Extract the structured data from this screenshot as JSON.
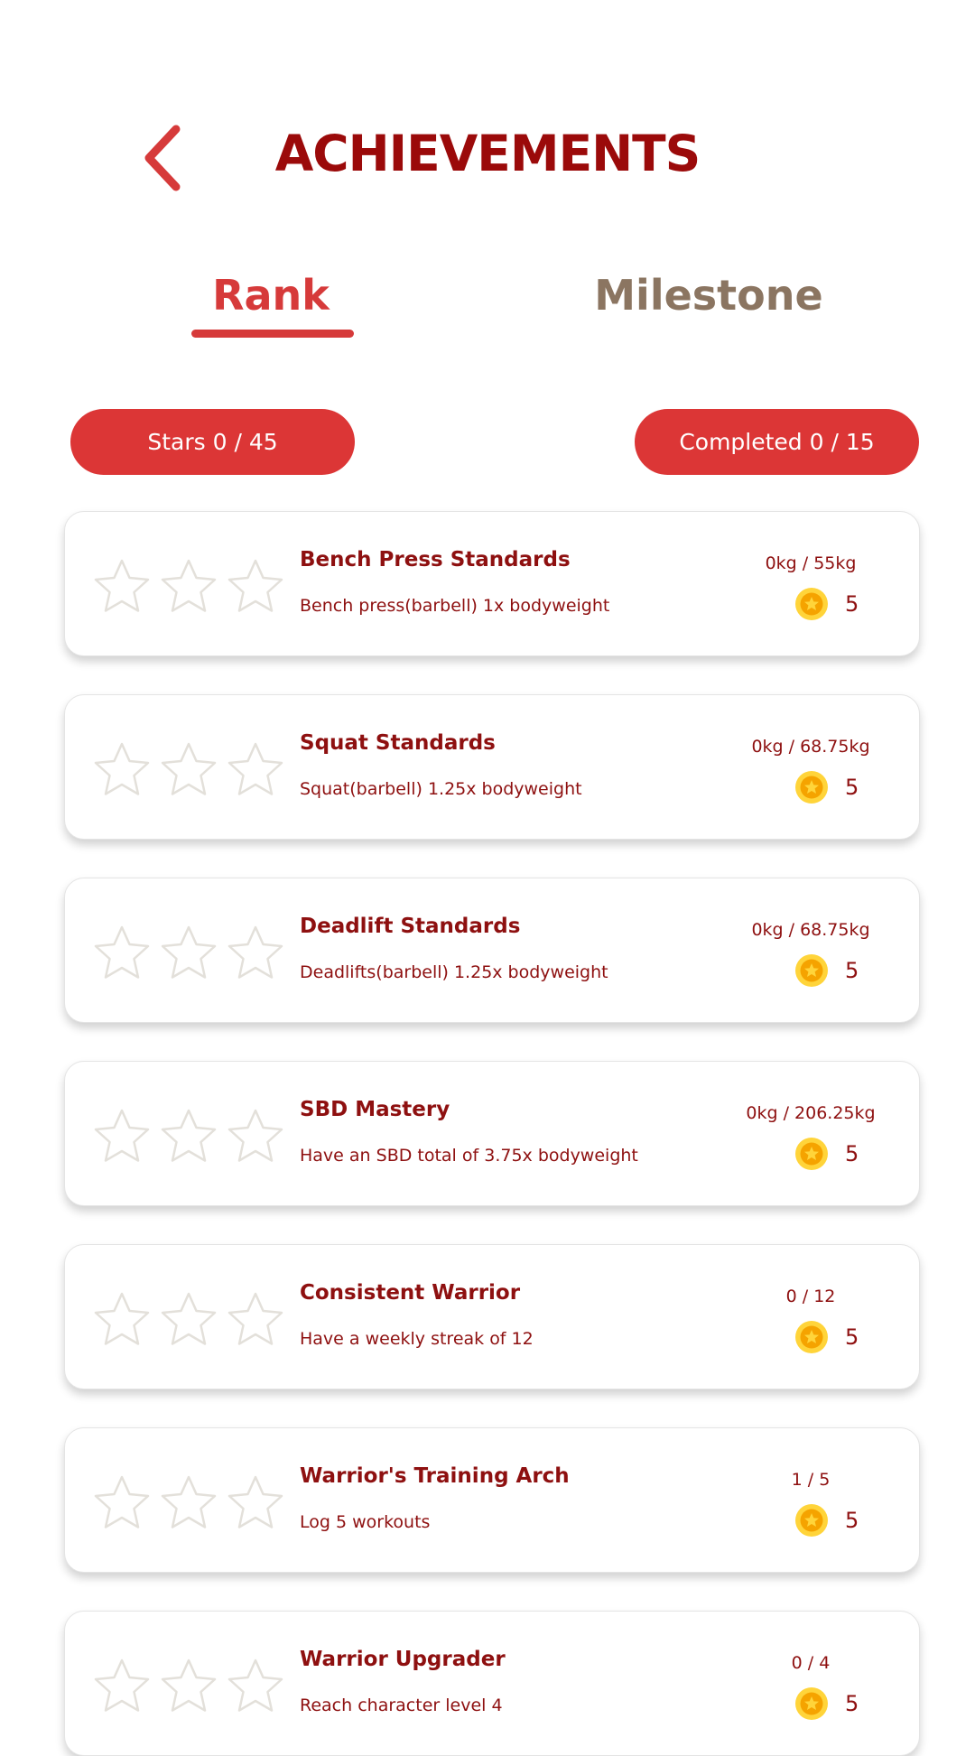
{
  "header": {
    "title": "ACHIEVEMENTS",
    "back_icon": "chevron-left-icon"
  },
  "tabs": [
    {
      "label": "Rank",
      "active": true
    },
    {
      "label": "Milestone",
      "active": false
    }
  ],
  "summary": {
    "stars": "Stars 0 / 45",
    "completed": "Completed 0 / 15"
  },
  "colors": {
    "accent": "#dc3636",
    "title": "#9b0a0a",
    "text": "#8e1010",
    "inactive_tab": "#8b7561",
    "coin": "#f5a300"
  },
  "achievements": [
    {
      "title": "Bench Press Standards",
      "description": "Bench press(barbell) 1x bodyweight",
      "progress": "0kg / 55kg",
      "reward": "5",
      "stars_earned": 0,
      "stars_total": 3
    },
    {
      "title": "Squat Standards",
      "description": "Squat(barbell) 1.25x bodyweight",
      "progress": "0kg / 68.75kg",
      "reward": "5",
      "stars_earned": 0,
      "stars_total": 3
    },
    {
      "title": "Deadlift Standards",
      "description": "Deadlifts(barbell) 1.25x bodyweight",
      "progress": "0kg / 68.75kg",
      "reward": "5",
      "stars_earned": 0,
      "stars_total": 3
    },
    {
      "title": "SBD Mastery",
      "description": "Have an SBD total of 3.75x bodyweight",
      "progress": "0kg / 206.25kg",
      "reward": "5",
      "stars_earned": 0,
      "stars_total": 3
    },
    {
      "title": "Consistent Warrior",
      "description": "Have a weekly streak of 12",
      "progress": "0 / 12",
      "reward": "5",
      "stars_earned": 0,
      "stars_total": 3
    },
    {
      "title": "Warrior's Training Arch",
      "description": "Log 5 workouts",
      "progress": "1 / 5",
      "reward": "5",
      "stars_earned": 0,
      "stars_total": 3
    },
    {
      "title": "Warrior Upgrader",
      "description": "Reach character level 4",
      "progress": "0 / 4",
      "reward": "5",
      "stars_earned": 0,
      "stars_total": 3
    }
  ]
}
